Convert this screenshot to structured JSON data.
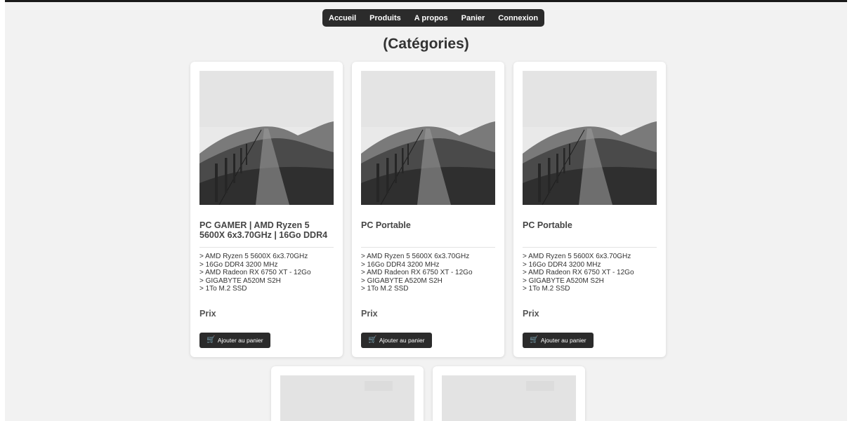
{
  "nav": {
    "items": [
      {
        "label": "Accueil"
      },
      {
        "label": "Produits"
      },
      {
        "label": "A propos"
      },
      {
        "label": "Panier"
      },
      {
        "label": "Connexion"
      }
    ]
  },
  "page": {
    "title": "(Catégories)"
  },
  "products": [
    {
      "title": "PC GAMER | AMD Ryzen 5 5600X 6x3.70GHz | 16Go DDR4",
      "specs": [
        "> AMD Ryzen 5 5600X 6x3.70GHz",
        "> 16Go DDR4 3200 MHz",
        "> AMD Radeon RX 6750 XT - 12Go",
        "> GIGABYTE A520M S2H",
        "> 1To M.2 SSD"
      ],
      "price_label": "Prix",
      "button_label": "Ajouter au panier"
    },
    {
      "title": "PC Portable",
      "specs": [
        "> AMD Ryzen 5 5600X 6x3.70GHz",
        "> 16Go DDR4 3200 MHz",
        "> AMD Radeon RX 6750 XT - 12Go",
        "> GIGABYTE A520M S2H",
        "> 1To M.2 SSD"
      ],
      "price_label": "Prix",
      "button_label": "Ajouter au panier"
    },
    {
      "title": "PC Portable",
      "specs": [
        "> AMD Ryzen 5 5600X 6x3.70GHz",
        "> 16Go DDR4 3200 MHz",
        "> AMD Radeon RX 6750 XT - 12Go",
        "> GIGABYTE A520M S2H",
        "> 1To M.2 SSD"
      ],
      "price_label": "Prix",
      "button_label": "Ajouter au panier"
    }
  ],
  "icons": {
    "cart": "cart-icon"
  },
  "colors": {
    "background": "#f2f2f2",
    "nav_background": "#2b2b2b",
    "button_background": "#2b2b2b",
    "card_background": "#ffffff"
  }
}
